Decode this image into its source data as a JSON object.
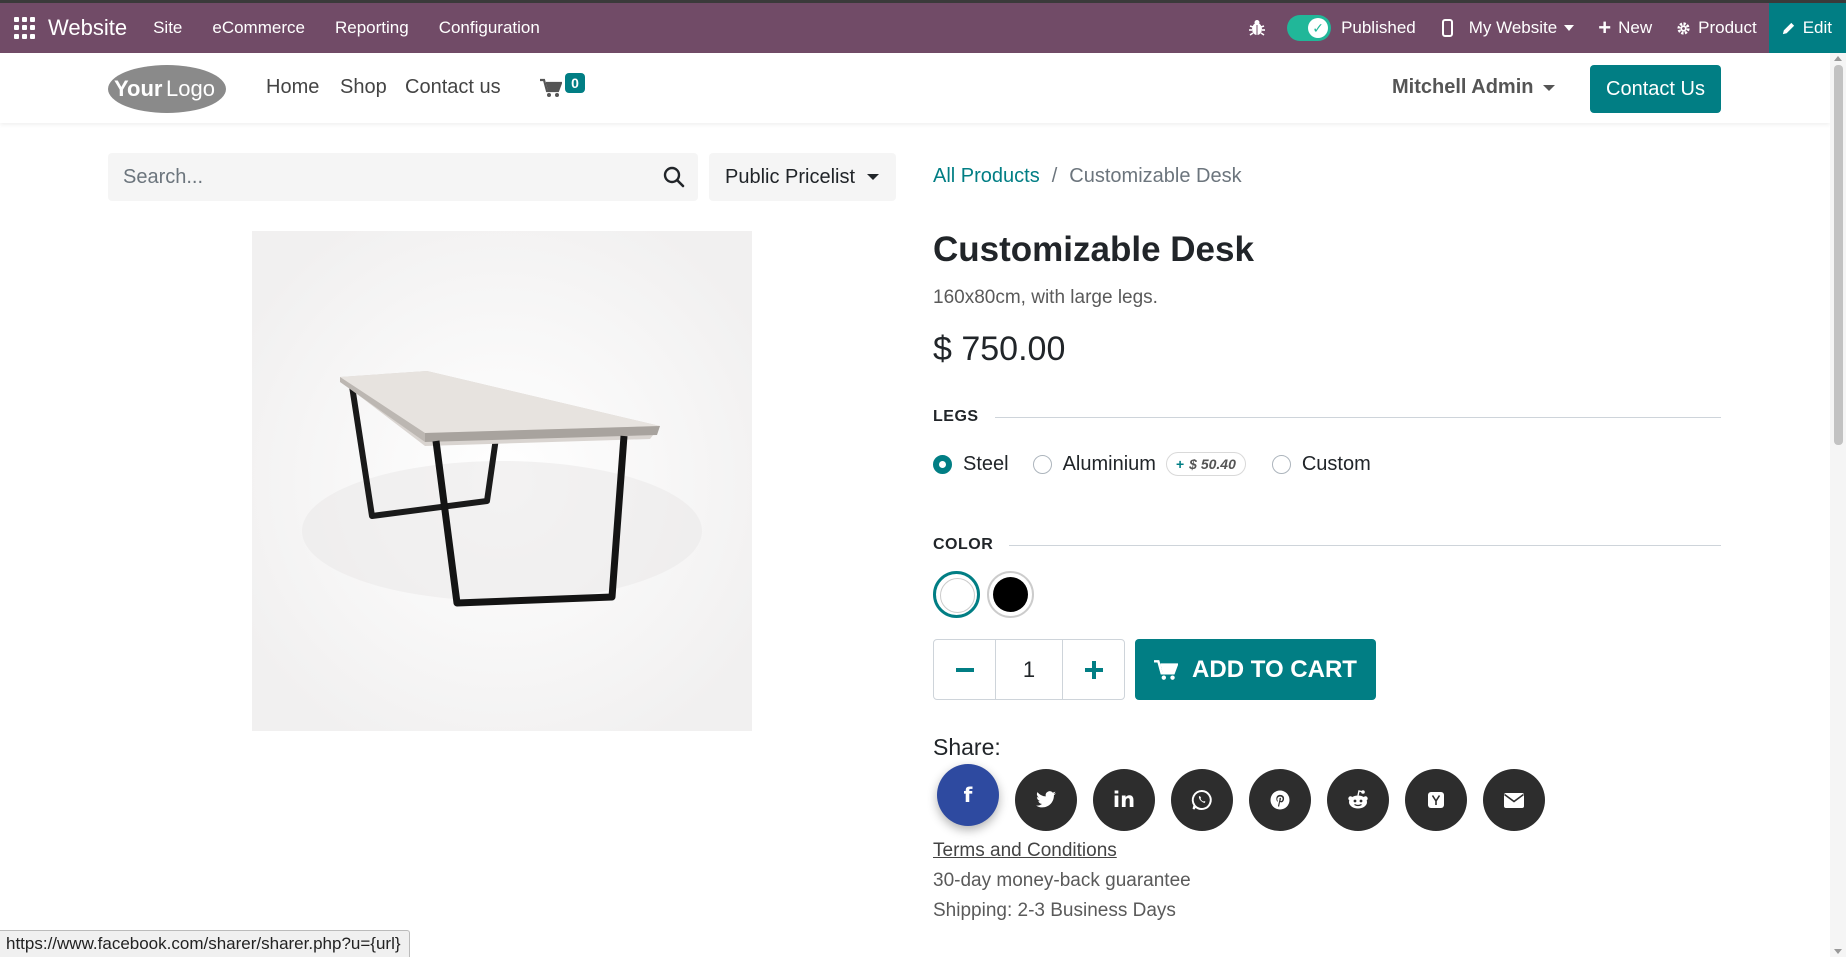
{
  "admin_bar": {
    "brand": "Website",
    "menu": [
      "Site",
      "eCommerce",
      "Reporting",
      "Configuration"
    ],
    "published_label": "Published",
    "website_selector": "My Website",
    "new_label": "New",
    "product_label": "Product",
    "edit_label": "Edit",
    "colors": {
      "bar": "#714B67",
      "edit": "#017e84",
      "toggle": "#21b799"
    }
  },
  "header": {
    "logo_text": "YourLogo",
    "nav": [
      "Home",
      "Shop",
      "Contact us"
    ],
    "cart_count": "0",
    "user": "Mitchell Admin",
    "contact_button": "Contact Us"
  },
  "search": {
    "placeholder": "Search...",
    "pricelist": "Public Pricelist"
  },
  "breadcrumb": {
    "parent": "All Products",
    "separator": "/",
    "current": "Customizable Desk"
  },
  "product": {
    "title": "Customizable Desk",
    "description": "160x80cm, with large legs.",
    "price": "$ 750.00",
    "legs": {
      "label": "LEGS",
      "options": [
        {
          "label": "Steel",
          "selected": true
        },
        {
          "label": "Aluminium",
          "selected": false,
          "extra": "$ 50.40"
        },
        {
          "label": "Custom",
          "selected": false
        }
      ]
    },
    "color": {
      "label": "COLOR",
      "options": [
        {
          "name": "White",
          "hex": "#ffffff",
          "selected": true
        },
        {
          "name": "Black",
          "hex": "#000000",
          "selected": false
        }
      ]
    },
    "quantity": "1",
    "add_to_cart": "ADD TO CART",
    "accent": "#017e84"
  },
  "share": {
    "label": "Share:",
    "networks": [
      "facebook-icon",
      "twitter-icon",
      "linkedin-icon",
      "whatsapp-icon",
      "pinterest-icon",
      "reddit-icon",
      "hacker-news-icon",
      "email-icon"
    ]
  },
  "footer_info": {
    "terms": "Terms and Conditions",
    "guarantee": "30-day money-back guarantee",
    "shipping": "Shipping: 2-3 Business Days"
  },
  "status_bar": {
    "url": "https://www.facebook.com/sharer/sharer.php?u={url}"
  }
}
